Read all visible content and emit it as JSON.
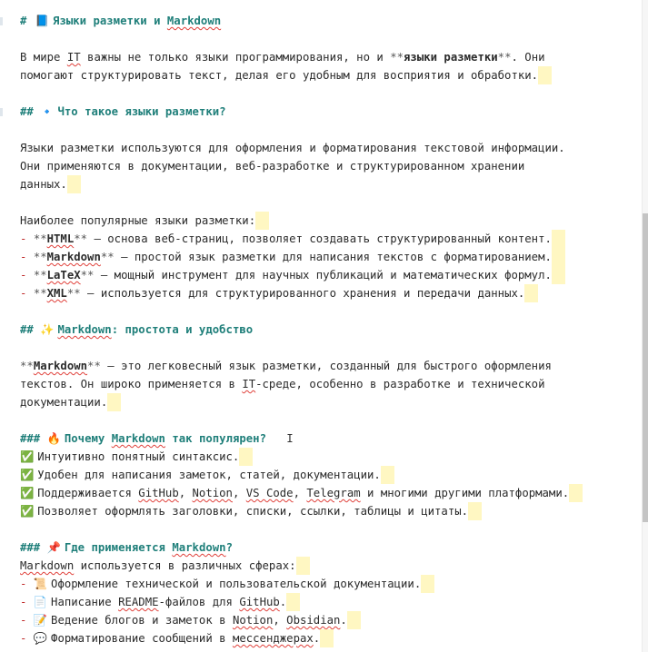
{
  "editor": {
    "lines": [
      {
        "type": "h1",
        "bookmark": true,
        "segs": [
          [
            "hash",
            "# "
          ],
          [
            "emoji",
            "📘 "
          ],
          [
            "head",
            "Языки разметки и "
          ],
          [
            "headsp",
            "Markdown"
          ]
        ]
      },
      {
        "type": "blank",
        "segs": []
      },
      {
        "type": "text",
        "segs": [
          [
            "t",
            "В мире "
          ],
          [
            "sp",
            "IT"
          ],
          [
            "t",
            " важны не только языки программирования, но и "
          ],
          [
            "m",
            "**"
          ],
          [
            "b",
            "языки разметки"
          ],
          [
            "m",
            "**"
          ],
          [
            "t",
            ". Они"
          ]
        ]
      },
      {
        "type": "text",
        "segs": [
          [
            "t",
            "помогают структурировать текст, делая его удобным для восприятия и обработки."
          ],
          [
            "eol",
            ""
          ]
        ]
      },
      {
        "type": "blank",
        "segs": []
      },
      {
        "type": "h2",
        "bookmark": true,
        "segs": [
          [
            "hash",
            "## "
          ],
          [
            "emoji",
            "🔹 "
          ],
          [
            "head",
            "Что такое языки разметки?"
          ]
        ]
      },
      {
        "type": "blank",
        "segs": []
      },
      {
        "type": "text",
        "segs": [
          [
            "t",
            "Языки разметки используются для оформления и форматирования текстовой информации."
          ]
        ]
      },
      {
        "type": "text",
        "segs": [
          [
            "t",
            "Они применяются в документации, веб-разработке и структурированном хранении"
          ]
        ]
      },
      {
        "type": "text",
        "segs": [
          [
            "t",
            "данных."
          ],
          [
            "eol",
            ""
          ]
        ]
      },
      {
        "type": "blank",
        "segs": []
      },
      {
        "type": "text",
        "segs": [
          [
            "t",
            "Наиболее популярные языки разметки:"
          ],
          [
            "eol",
            ""
          ]
        ]
      },
      {
        "type": "li",
        "segs": [
          [
            "bullet",
            "- "
          ],
          [
            "m",
            "**"
          ],
          [
            "bsp",
            "HTML"
          ],
          [
            "m",
            "**"
          ],
          [
            "t",
            " — основа веб-страниц, позволяет создавать структурированный контент."
          ],
          [
            "eol",
            ""
          ]
        ]
      },
      {
        "type": "li",
        "segs": [
          [
            "bullet",
            "- "
          ],
          [
            "m",
            "**"
          ],
          [
            "bsp",
            "Markdown"
          ],
          [
            "m",
            "**"
          ],
          [
            "t",
            " — простой язык разметки для написания текстов с форматированием."
          ],
          [
            "eol",
            ""
          ]
        ]
      },
      {
        "type": "li",
        "segs": [
          [
            "bullet",
            "- "
          ],
          [
            "m",
            "**"
          ],
          [
            "bsp",
            "LaTeX"
          ],
          [
            "m",
            "**"
          ],
          [
            "t",
            " — мощный инструмент для научных публикаций и математических формул."
          ],
          [
            "eol",
            ""
          ]
        ]
      },
      {
        "type": "li",
        "segs": [
          [
            "bullet",
            "- "
          ],
          [
            "m",
            "**"
          ],
          [
            "bsp",
            "XML"
          ],
          [
            "m",
            "**"
          ],
          [
            "t",
            " — используется для структурированного хранения и передачи данных."
          ],
          [
            "eol",
            ""
          ]
        ]
      },
      {
        "type": "blank",
        "segs": []
      },
      {
        "type": "h2",
        "bookmark": false,
        "segs": [
          [
            "hash",
            "## "
          ],
          [
            "emoji",
            "✨ "
          ],
          [
            "headsp",
            "Markdown"
          ],
          [
            "head",
            ": простота и удобство"
          ]
        ]
      },
      {
        "type": "blank",
        "segs": []
      },
      {
        "type": "text",
        "segs": [
          [
            "m",
            "**"
          ],
          [
            "bsp",
            "Markdown"
          ],
          [
            "m",
            "**"
          ],
          [
            "t",
            " — это легковесный язык разметки, созданный для быстрого оформления"
          ]
        ]
      },
      {
        "type": "text",
        "segs": [
          [
            "t",
            "текстов. Он широко применяется в "
          ],
          [
            "sp",
            "IT"
          ],
          [
            "t",
            "-среде, особенно в разработке и технической"
          ]
        ]
      },
      {
        "type": "text",
        "segs": [
          [
            "t",
            "документации."
          ],
          [
            "eol",
            ""
          ]
        ]
      },
      {
        "type": "blank",
        "segs": []
      },
      {
        "type": "h3",
        "bookmark": false,
        "segs": [
          [
            "hash",
            "### "
          ],
          [
            "emoji",
            "🔥 "
          ],
          [
            "head",
            "Почему "
          ],
          [
            "headsp",
            "Markdown"
          ],
          [
            "head",
            " так популярен?"
          ],
          [
            "cursor",
            "   𝙸"
          ]
        ]
      },
      {
        "type": "li",
        "segs": [
          [
            "emoji",
            "✅ "
          ],
          [
            "t",
            "Интуитивно понятный синтаксис."
          ],
          [
            "eol",
            ""
          ]
        ]
      },
      {
        "type": "li",
        "segs": [
          [
            "emoji",
            "✅ "
          ],
          [
            "t",
            "Удобен для написания заметок, статей, документации."
          ],
          [
            "eol",
            ""
          ]
        ]
      },
      {
        "type": "li",
        "segs": [
          [
            "emoji",
            "✅ "
          ],
          [
            "t",
            "Поддерживается "
          ],
          [
            "sp",
            "GitHub"
          ],
          [
            "t",
            ", "
          ],
          [
            "sp",
            "Notion"
          ],
          [
            "t",
            ", "
          ],
          [
            "sp",
            "VS Code"
          ],
          [
            "t",
            ", "
          ],
          [
            "sp",
            "Telegram"
          ],
          [
            "t",
            " и многими другими платформами."
          ],
          [
            "eol",
            ""
          ]
        ]
      },
      {
        "type": "li",
        "segs": [
          [
            "emoji",
            "✅ "
          ],
          [
            "t",
            "Позволяет оформлять заголовки, списки, ссылки, таблицы и цитаты."
          ],
          [
            "eol",
            ""
          ]
        ]
      },
      {
        "type": "blank",
        "segs": []
      },
      {
        "type": "h3",
        "bookmark": false,
        "segs": [
          [
            "hash",
            "### "
          ],
          [
            "emoji",
            "📌 "
          ],
          [
            "head",
            "Где применяется "
          ],
          [
            "headsp",
            "Markdown"
          ],
          [
            "head",
            "?"
          ]
        ]
      },
      {
        "type": "text",
        "segs": [
          [
            "sp",
            "Markdown"
          ],
          [
            "t",
            " используется в различных сферах:"
          ],
          [
            "eol",
            ""
          ]
        ]
      },
      {
        "type": "li",
        "segs": [
          [
            "bullet",
            "- "
          ],
          [
            "emoji",
            "📜 "
          ],
          [
            "t",
            "Оформление технической и пользовательской документации."
          ],
          [
            "eol",
            ""
          ]
        ]
      },
      {
        "type": "li",
        "segs": [
          [
            "bullet",
            "- "
          ],
          [
            "emoji",
            "📄 "
          ],
          [
            "t",
            "Написание "
          ],
          [
            "sp",
            "README"
          ],
          [
            "t",
            "-файлов для "
          ],
          [
            "sp",
            "GitHub"
          ],
          [
            "t",
            "."
          ],
          [
            "eol",
            ""
          ]
        ]
      },
      {
        "type": "li",
        "segs": [
          [
            "bullet",
            "- "
          ],
          [
            "emoji",
            "📝 "
          ],
          [
            "t",
            "Ведение блогов и заметок в "
          ],
          [
            "sp",
            "Notion"
          ],
          [
            "t",
            ", "
          ],
          [
            "sp",
            "Obsidian"
          ],
          [
            "t",
            "."
          ],
          [
            "eol",
            ""
          ]
        ]
      },
      {
        "type": "li",
        "segs": [
          [
            "bullet",
            "- "
          ],
          [
            "emoji",
            "💬 "
          ],
          [
            "t",
            "Форматирование сообщений в "
          ],
          [
            "sp",
            "мессенджерах"
          ],
          [
            "t",
            "."
          ],
          [
            "eol",
            ""
          ]
        ]
      }
    ]
  }
}
